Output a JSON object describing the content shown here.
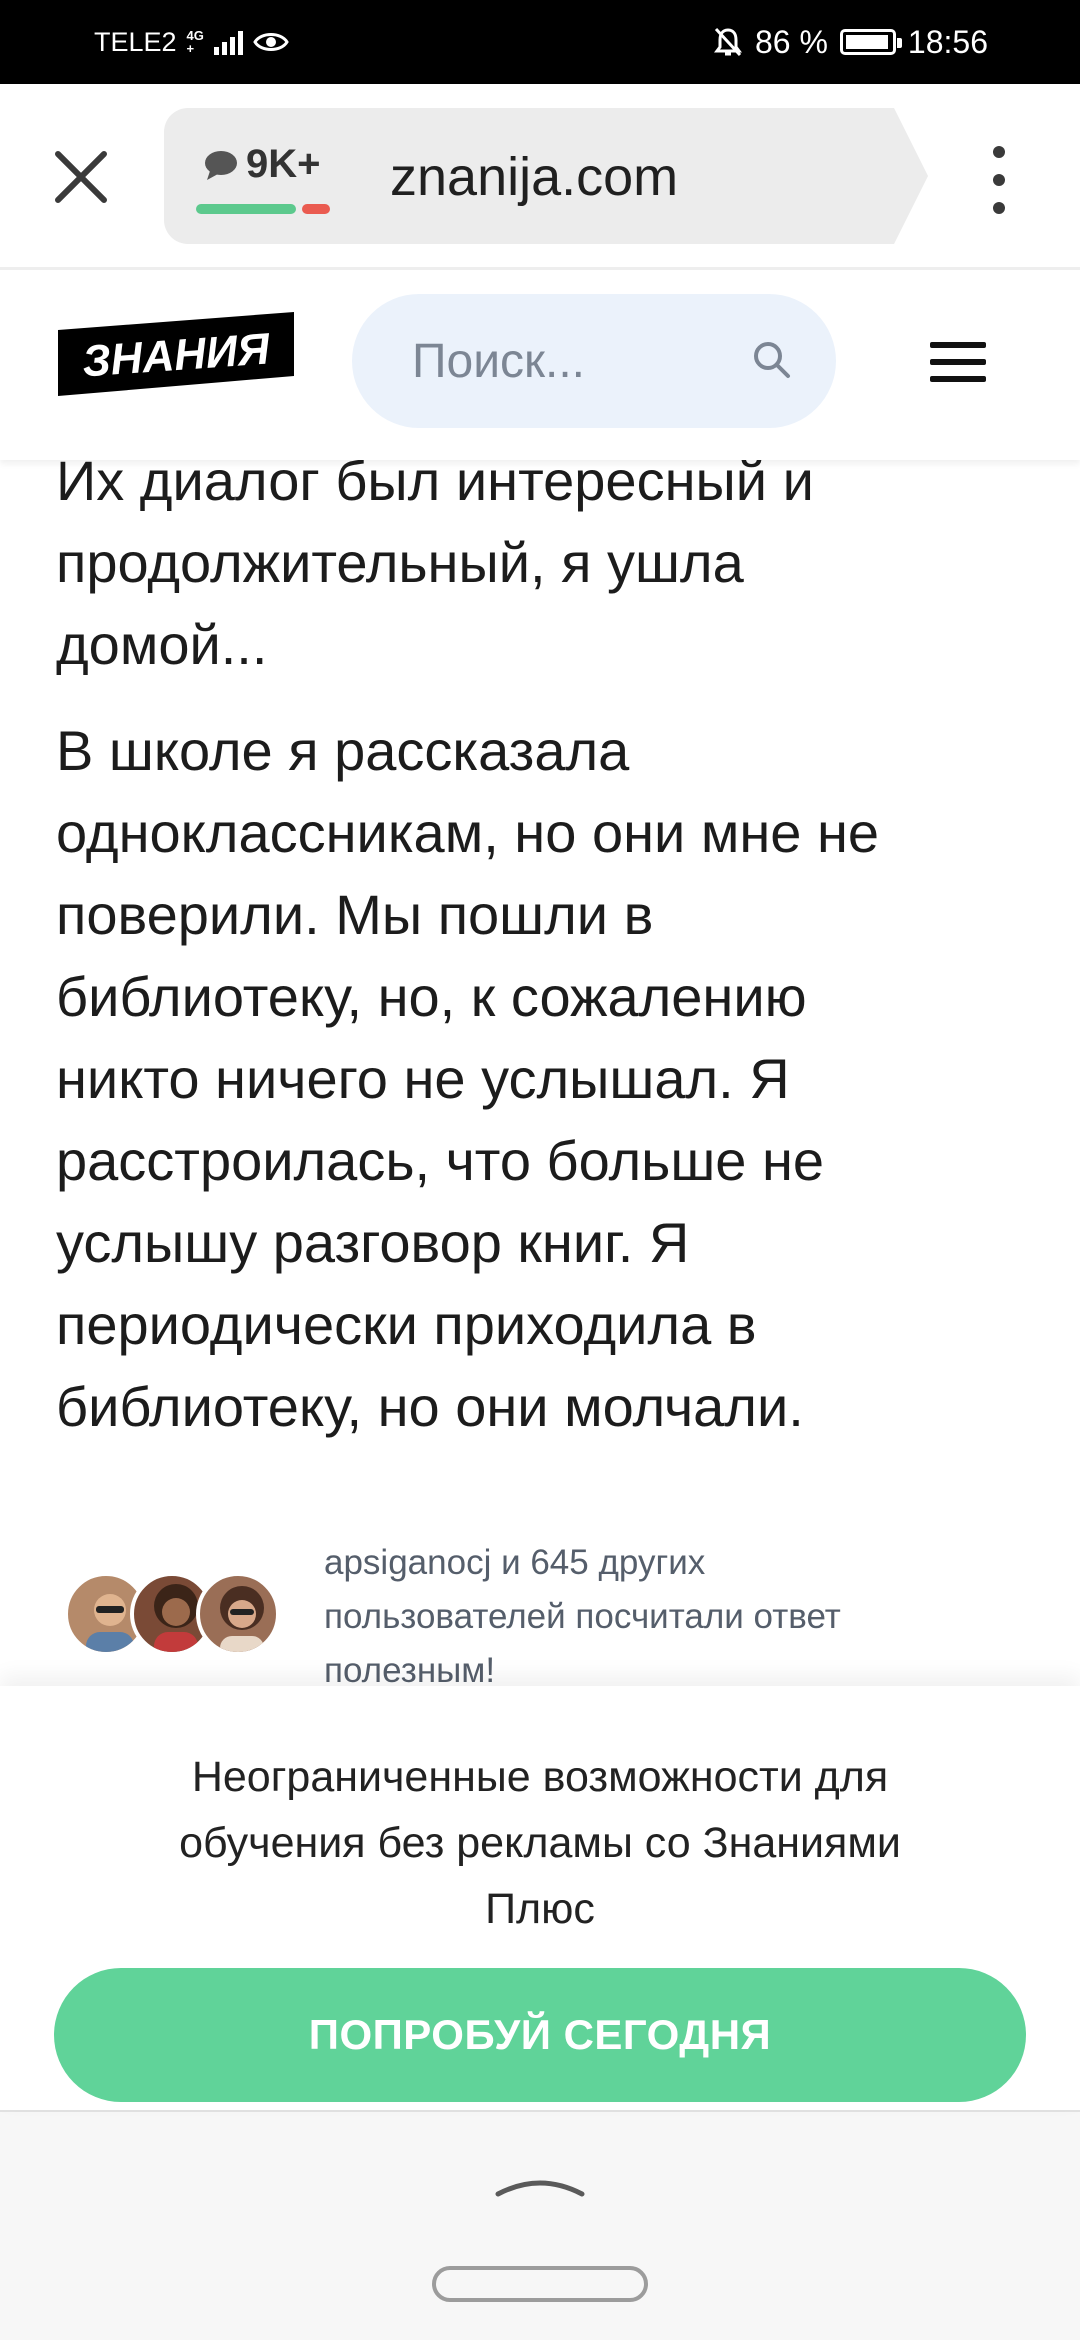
{
  "status_bar": {
    "carrier": "TELE2",
    "network_top": "4G",
    "network_bottom": "+",
    "battery_percent": "86 %",
    "time": "18:56"
  },
  "browser": {
    "comments_count": "9K+",
    "url": "znanija.com"
  },
  "site_header": {
    "logo_text": "ЗНАНИЯ",
    "search_placeholder": "Поиск..."
  },
  "article": {
    "intro_lines": [
      "Их диалог был интересный и",
      "продолжительный, я ушла",
      "домой..."
    ],
    "main_lines": [
      "В школе я  рассказала",
      "одноклассникам, но они мне не",
      "поверили. Мы пошли в",
      "библиотеку, но, к сожалению",
      "никто ничего не услышал. Я",
      "расстроилась, что больше не",
      "услышу разговор книг. Я",
      "периодически приходила в",
      "библиотеку, но они молчали."
    ]
  },
  "helpful": {
    "lines": [
      "apsiganocj и 645 других",
      "пользователей посчитали ответ",
      "полезным!"
    ]
  },
  "promo": {
    "lines": [
      "Неограниченные возможности для",
      "обучения без рекламы со Знаниями",
      "Плюс"
    ],
    "cta_label": "ПОПРОБУЙ СЕГОДНЯ"
  },
  "colors": {
    "accent_green": "#60d399",
    "search_bg": "#ebf2fb",
    "bar_red": "#ea5b50"
  }
}
